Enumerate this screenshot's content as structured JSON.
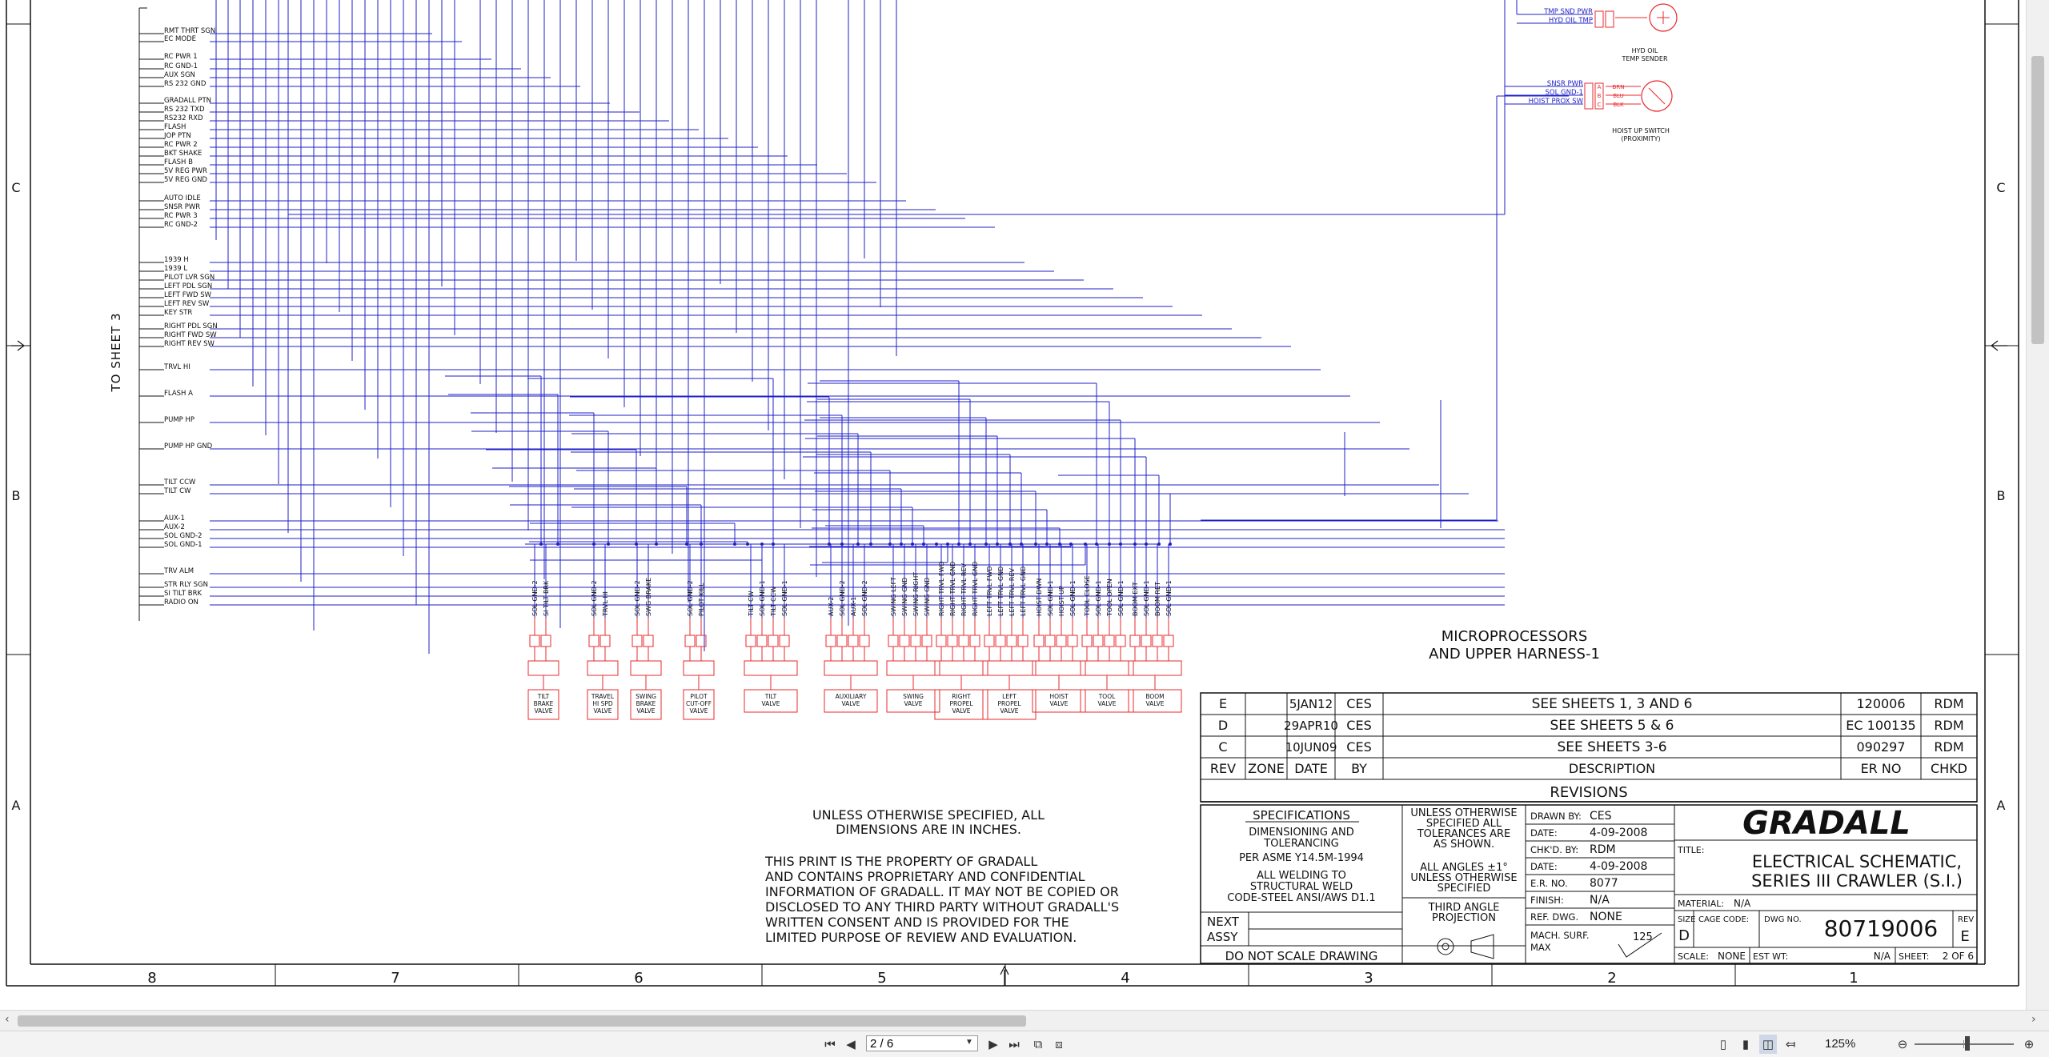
{
  "drawing": {
    "grid_columns": [
      "8",
      "7",
      "6",
      "5",
      "4",
      "3",
      "2",
      "1"
    ],
    "grid_rows_left": [
      "C",
      "B",
      "A"
    ],
    "grid_rows_right": [
      "C",
      "B",
      "A"
    ],
    "to_sheet": "TO SHEET 3",
    "left_signals": [
      "RMT THRT SGN",
      "EC MODE",
      "RC PWR 1",
      "RC GND-1",
      "AUX SGN",
      "RS 232 GND",
      "GRADALL PTN",
      "RS 232 TXD",
      "RS232 RXD",
      "FLASH",
      "JOP PTN",
      "RC PWR 2",
      "BKT SHAKE",
      "FLASH B",
      "5V REG PWR",
      "5V REG GND",
      "AUTO IDLE",
      "SNSR PWR",
      "RC PWR 3",
      "RC GND-2",
      "1939 H",
      "1939 L",
      "PILOT LVR SGN",
      "LEFT PDL SGN",
      "LEFT FWD SW",
      "LEFT REV SW",
      "KEY STR",
      "RIGHT PDL SGN",
      "RIGHT FWD SW",
      "RIGHT REV SW",
      "TRVL HI",
      "FLASH A",
      "PUMP HP",
      "PUMP HP GND",
      "TILT CCW",
      "TILT CW",
      "AUX-1",
      "AUX-2",
      "SOL GND-2",
      "SOL GND-1",
      "TRV ALM",
      "STR RLY SGN",
      "SI TILT BRK",
      "RADIO ON"
    ],
    "sensors": {
      "hyd_oil": {
        "lines": [
          "TMP SND PWR",
          "HYD OIL TMP"
        ],
        "label_1": "HYD OIL",
        "label_2": "TEMP SENDER"
      },
      "hoist_up": {
        "lines": [
          "SNSR PWR",
          "SOL GND-1",
          "HOIST PROX SW"
        ],
        "pins": [
          "A",
          "B",
          "C"
        ],
        "colors": [
          "BRN",
          "BLU",
          "BLK"
        ],
        "label_1": "HOIST UP SWITCH",
        "label_2": "(PROXIMITY)"
      }
    },
    "valves": [
      {
        "wires": [
          "SOL GND-2",
          "SI TILT BRK"
        ],
        "label": [
          "TILT",
          "BRAKE",
          "VALVE"
        ]
      },
      {
        "wires": [
          "SOL GND-2",
          "TRVL HI"
        ],
        "label": [
          "TRAVEL",
          "HI SPD",
          "VALVE"
        ]
      },
      {
        "wires": [
          "SOL GND-2",
          "SWG BRAKE"
        ],
        "label": [
          "SWING",
          "BRAKE",
          "VALVE"
        ]
      },
      {
        "wires": [
          "SOL GND-2",
          "PILOT KILL"
        ],
        "label": [
          "PILOT",
          "CUT-OFF",
          "VALVE"
        ]
      },
      {
        "wires": [
          "TILT CW",
          "SOL GND-1",
          "TILT CCW",
          "SOL GND-1"
        ],
        "label": [
          "TILT",
          "VALVE"
        ]
      },
      {
        "wires": [
          "AUX-2",
          "SOL GND-2",
          "AUX-1",
          "SOL GND-2"
        ],
        "label": [
          "AUXILIARY",
          "VALVE"
        ]
      },
      {
        "wires": [
          "SWING LEFT",
          "SWING GND",
          "SWING RIGHT",
          "SWING GND"
        ],
        "label": [
          "SWING",
          "VALVE"
        ]
      },
      {
        "wires": [
          "RIGHT TRVL FWD",
          "RIGHT TRVL GND",
          "RIGHT TRVL REV",
          "RIGHT TRVL GND"
        ],
        "label": [
          "RIGHT",
          "PROPEL",
          "VALVE"
        ]
      },
      {
        "wires": [
          "LEFT TRVL FWD",
          "LEFT TRVL GND",
          "LEFT TRVL REV",
          "LEFT TRVL GND"
        ],
        "label": [
          "LEFT",
          "PROPEL",
          "VALVE"
        ]
      },
      {
        "wires": [
          "HOIST DWN",
          "SOL GND-1",
          "HOIST UP",
          "SOL GND-1"
        ],
        "label": [
          "HOIST",
          "VALVE"
        ]
      },
      {
        "wires": [
          "TOOL CLOSE",
          "SOL GND-1",
          "TOOL OPEN",
          "SOL GND-1"
        ],
        "label": [
          "TOOL",
          "VALVE"
        ]
      },
      {
        "wires": [
          "BOOM EXT",
          "SOL GND-1",
          "BOOM RET",
          "SOL GND-1"
        ],
        "label": [
          "BOOM",
          "VALVE"
        ]
      }
    ],
    "title_caption": [
      "MICROPROCESSORS",
      "AND UPPER HARNESS-1"
    ],
    "revisions": {
      "rows": [
        {
          "rev": "E",
          "zone": "",
          "date": "5JAN12",
          "by": "CES",
          "desc": "SEE SHEETS 1, 3 AND 6",
          "er": "120006",
          "chkd": "RDM"
        },
        {
          "rev": "D",
          "zone": "",
          "date": "29APR10",
          "by": "CES",
          "desc": "SEE SHEETS 5 & 6",
          "er": "EC 100135",
          "chkd": "RDM"
        },
        {
          "rev": "C",
          "zone": "",
          "date": "10JUN09",
          "by": "CES",
          "desc": "SEE SHEETS 3-6",
          "er": "090297",
          "chkd": "RDM"
        }
      ],
      "headers": [
        "REV",
        "ZONE",
        "DATE",
        "BY",
        "DESCRIPTION",
        "ER NO",
        "CHKD"
      ],
      "caption": "REVISIONS"
    },
    "notes": {
      "unless": [
        "UNLESS OTHERWISE SPECIFIED, ALL",
        "DIMENSIONS ARE IN INCHES."
      ],
      "property": [
        "THIS PRINT IS THE PROPERTY OF GRADALL",
        "AND CONTAINS PROPRIETARY AND CONFIDENTIAL",
        "INFORMATION OF GRADALL. IT MAY NOT BE COPIED OR",
        "DISCLOSED TO ANY THIRD PARTY WITHOUT GRADALL'S",
        "WRITTEN CONSENT AND IS PROVIDED FOR THE",
        "LIMITED PURPOSE OF REVIEW AND EVALUATION."
      ]
    },
    "title_block": {
      "specs_title": "SPECIFICATIONS",
      "specs": [
        "DIMENSIONING AND",
        "TOLERANCING",
        "PER ASME Y14.5M-1994",
        "ALL WELDING TO",
        "STRUCTURAL WELD",
        "CODE-STEEL ANSI/AWS D1.1"
      ],
      "tol": [
        "UNLESS OTHERWISE",
        "SPECIFIED ALL",
        "TOLERANCES ARE",
        "AS SHOWN.",
        "ALL ANGLES ±1°",
        "UNLESS OTHERWISE",
        "SPECIFIED"
      ],
      "projection": [
        "THIRD ANGLE",
        "PROJECTION"
      ],
      "next_assy": [
        "NEXT",
        "ASSY"
      ],
      "do_not_scale": "DO NOT SCALE DRAWING",
      "drawn_by_label": "DRAWN BY:",
      "drawn_by": "CES",
      "date_label": "DATE:",
      "date": "4-09-2008",
      "chkd_by_label": "CHK'D. BY:",
      "chkd_by": "RDM",
      "date2": "4-09-2008",
      "er_no_label": "E.R. NO.",
      "er_no": "8077",
      "finish_label": "FINISH:",
      "finish": "N/A",
      "ref_dwg_label": "REF. DWG.",
      "ref_dwg": "NONE",
      "mach_surf": [
        "MACH. SURF.",
        "MAX"
      ],
      "mach_val": "125",
      "logo": "GRADALL",
      "title_label": "TITLE:",
      "title": [
        "ELECTRICAL SCHEMATIC,",
        "SERIES III CRAWLER (S.I.)"
      ],
      "material_label": "MATERIAL:",
      "material": "N/A",
      "size_label": "SIZE",
      "size": "D",
      "cage_label": "CAGE CODE:",
      "dwg_no_label": "DWG NO.",
      "dwg_no": "80719006",
      "rev_label": "REV",
      "rev": "E",
      "scale_label": "SCALE:",
      "scale": "NONE",
      "est_wt_label": "EST WT:",
      "est_wt": "N/A",
      "sheet_label": "SHEET:",
      "sheet": "2 OF 6"
    }
  },
  "viewer": {
    "page_field": "2 / 6",
    "page_number": 2,
    "page_count": 6,
    "zoom": "125%"
  }
}
